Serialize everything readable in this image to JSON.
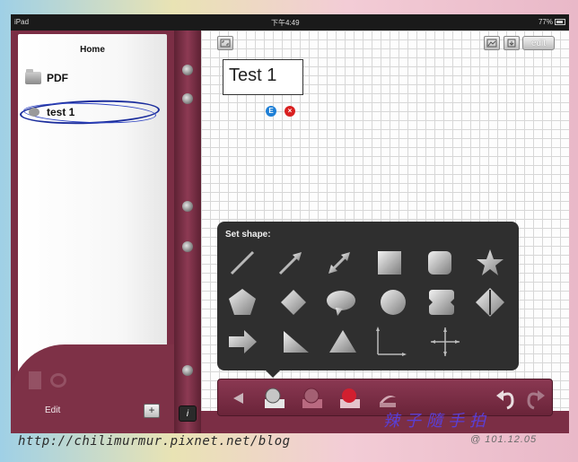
{
  "status_bar": {
    "device": "iPad",
    "time": "下午4:49",
    "battery": "77%"
  },
  "sidebar": {
    "title": "Home",
    "items": [
      {
        "label": "PDF",
        "icon": "folder-icon"
      },
      {
        "label": "test 1",
        "icon": "note-bubble-icon"
      }
    ],
    "edit_label": "Edit",
    "add_label": "+"
  },
  "spine": {
    "info_label": "i"
  },
  "canvas": {
    "edit_label": "edit",
    "text_box": "Test 1",
    "edit_dot": "E",
    "delete_dot": "×"
  },
  "shape_popover": {
    "title": "Set shape:",
    "shapes": [
      "line",
      "arrow",
      "double-arrow",
      "square",
      "rounded-square",
      "star",
      "pentagon",
      "diamond",
      "speech-bubble",
      "circle",
      "notched-rectangle",
      "diamond-arrows",
      "block-arrow",
      "right-triangle",
      "triangle",
      "axes",
      "crosshair-arrows"
    ]
  },
  "bottom_toolbar": {
    "icons": [
      "back-arrow-icon",
      "shape-tool-icon",
      "shape-fill-icon",
      "red-shape-icon",
      "eraser-icon",
      "undo-icon",
      "redo-icon"
    ]
  },
  "watermarks": {
    "url": "http://chilimurmur.pixnet.net/blog",
    "chinese": "辣子隨手拍",
    "date": "@ 101.12.05"
  }
}
